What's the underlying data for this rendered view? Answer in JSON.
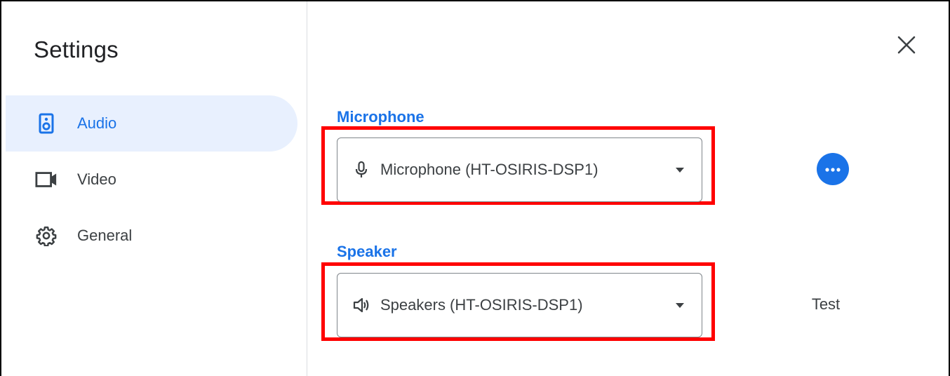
{
  "dialog": {
    "title": "Settings",
    "close_icon": "close-icon"
  },
  "sidebar": {
    "items": [
      {
        "label": "Audio",
        "icon": "speaker-icon",
        "active": true
      },
      {
        "label": "Video",
        "icon": "videocam-icon",
        "active": false
      },
      {
        "label": "General",
        "icon": "gear-icon",
        "active": false
      }
    ]
  },
  "audio": {
    "microphone": {
      "section_label": "Microphone",
      "selected": "Microphone (HT-OSIRIS-DSP1)",
      "icon": "mic-icon",
      "more_icon": "more-horiz-icon"
    },
    "speaker": {
      "section_label": "Speaker",
      "selected": "Speakers (HT-OSIRIS-DSP1)",
      "icon": "volume-icon",
      "test_label": "Test"
    }
  },
  "colors": {
    "accent": "#1a73e8",
    "active_bg": "#e8f0fe",
    "highlight": "#ff0000",
    "text": "#3c4043"
  }
}
